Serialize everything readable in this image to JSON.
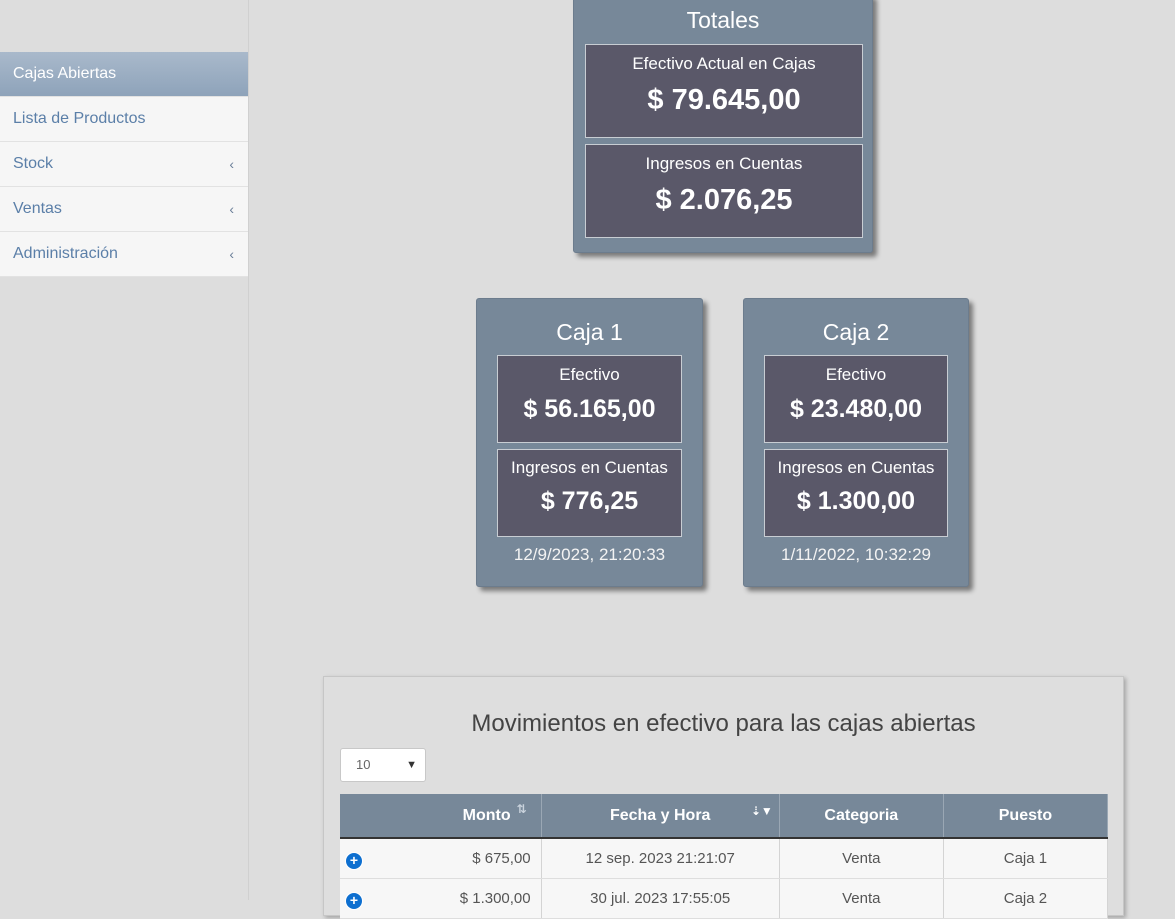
{
  "sidebar": {
    "items": [
      {
        "label": "Cajas Abiertas",
        "active": true
      },
      {
        "label": "Lista de Productos"
      },
      {
        "label": "Stock",
        "chevron": "‹"
      },
      {
        "label": "Ventas",
        "chevron": "‹"
      },
      {
        "label": "Administración",
        "chevron": "‹"
      }
    ]
  },
  "totales": {
    "title": "Totales",
    "efectivo_label": "Efectivo Actual en Cajas",
    "efectivo_value": "$ 79.645,00",
    "ingresos_label": "Ingresos en Cuentas",
    "ingresos_value": "$ 2.076,25"
  },
  "cajas": [
    {
      "title": "Caja 1",
      "efectivo_label": "Efectivo",
      "efectivo_value": "$ 56.165,00",
      "ingresos_label": "Ingresos en Cuentas",
      "ingresos_value": "$ 776,25",
      "fecha": "12/9/2023, 21:20:33"
    },
    {
      "title": "Caja 2",
      "efectivo_label": "Efectivo",
      "efectivo_value": "$ 23.480,00",
      "ingresos_label": "Ingresos en Cuentas",
      "ingresos_value": "$ 1.300,00",
      "fecha": "1/11/2022, 10:32:29"
    }
  ],
  "movimientos": {
    "title": "Movimientos en efectivo para las cajas abiertas",
    "page_length": "10",
    "columns": [
      "Monto",
      "Fecha y Hora",
      "Categoria",
      "Puesto"
    ],
    "rows": [
      {
        "monto": "$ 675,00",
        "fecha": "12 sep. 2023 21:21:07",
        "categoria": "Venta",
        "puesto": "Caja 1"
      },
      {
        "monto": "$ 1.300,00",
        "fecha": "30 jul. 2023 17:55:05",
        "categoria": "Venta",
        "puesto": "Caja 2"
      }
    ]
  },
  "colors": {
    "card_bg": "#778899",
    "panel_bg": "#5a5869",
    "page_bg": "#dddddd",
    "link": "#5b7fa8",
    "expand_icon": "#0d6fd0"
  }
}
